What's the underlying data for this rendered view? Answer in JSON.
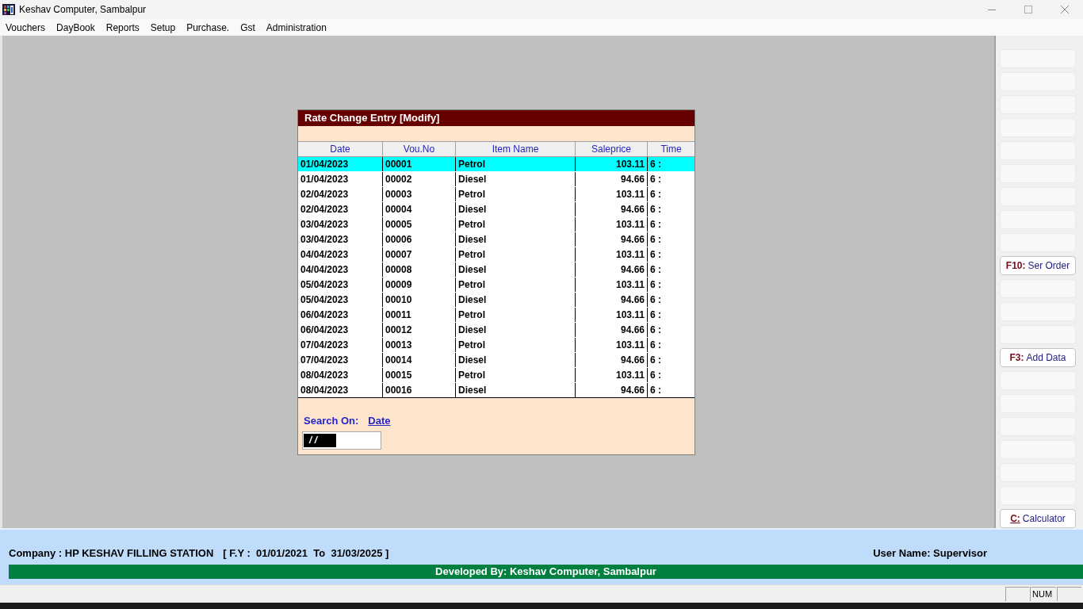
{
  "window": {
    "title": "Keshav Computer, Sambalpur"
  },
  "menu_bar": [
    "Vouchers",
    "DayBook",
    "Reports",
    "Setup",
    "Purchase.",
    "Gst",
    "Administration"
  ],
  "dialog": {
    "title": "Rate Change Entry [Modify]",
    "table": {
      "columns": [
        "Date",
        "Vou.No",
        "Item Name",
        "Saleprice",
        "Time"
      ],
      "rows": [
        {
          "cells": [
            "01/04/2023",
            "00001",
            "Petrol",
            "103.11",
            "6 :"
          ],
          "selected": true
        },
        {
          "cells": [
            "01/04/2023",
            "00002",
            "Diesel",
            "94.66",
            "6 :"
          ],
          "selected": false
        },
        {
          "cells": [
            "02/04/2023",
            "00003",
            "Petrol",
            "103.11",
            "6 :"
          ],
          "selected": false
        },
        {
          "cells": [
            "02/04/2023",
            "00004",
            "Diesel",
            "94.66",
            "6 :"
          ],
          "selected": false
        },
        {
          "cells": [
            "03/04/2023",
            "00005",
            "Petrol",
            "103.11",
            "6 :"
          ],
          "selected": false
        },
        {
          "cells": [
            "03/04/2023",
            "00006",
            "Diesel",
            "94.66",
            "6 :"
          ],
          "selected": false
        },
        {
          "cells": [
            "04/04/2023",
            "00007",
            "Petrol",
            "103.11",
            "6 :"
          ],
          "selected": false
        },
        {
          "cells": [
            "04/04/2023",
            "00008",
            "Diesel",
            "94.66",
            "6 :"
          ],
          "selected": false
        },
        {
          "cells": [
            "05/04/2023",
            "00009",
            "Petrol",
            "103.11",
            "6 :"
          ],
          "selected": false
        },
        {
          "cells": [
            "05/04/2023",
            "00010",
            "Diesel",
            "94.66",
            "6 :"
          ],
          "selected": false
        },
        {
          "cells": [
            "06/04/2023",
            "00011",
            "Petrol",
            "103.11",
            "6 :"
          ],
          "selected": false
        },
        {
          "cells": [
            "06/04/2023",
            "00012",
            "Diesel",
            "94.66",
            "6 :"
          ],
          "selected": false
        },
        {
          "cells": [
            "07/04/2023",
            "00013",
            "Petrol",
            "103.11",
            "6 :"
          ],
          "selected": false
        },
        {
          "cells": [
            "07/04/2023",
            "00014",
            "Diesel",
            "94.66",
            "6 :"
          ],
          "selected": false
        },
        {
          "cells": [
            "08/04/2023",
            "00015",
            "Petrol",
            "103.11",
            "6 :"
          ],
          "selected": false
        },
        {
          "cells": [
            "08/04/2023",
            "00016",
            "Diesel",
            "94.66",
            "6 :"
          ],
          "selected": false
        }
      ]
    },
    "search": {
      "label": "Search On:",
      "field": "Date",
      "value": "/ /",
      "value_selected": true
    }
  },
  "side_panel": {
    "buttons": [
      {
        "kind": "blank"
      },
      {
        "kind": "blank"
      },
      {
        "kind": "blank"
      },
      {
        "kind": "blank"
      },
      {
        "kind": "blank"
      },
      {
        "kind": "blank"
      },
      {
        "kind": "blank"
      },
      {
        "kind": "blank"
      },
      {
        "kind": "blank"
      },
      {
        "kind": "command",
        "key": "F10:",
        "label": "Ser Order",
        "underlined": false
      },
      {
        "kind": "blank"
      },
      {
        "kind": "blank"
      },
      {
        "kind": "blank"
      },
      {
        "kind": "command",
        "key": "F3:",
        "label": "Add Data",
        "underlined": false
      },
      {
        "kind": "blank"
      },
      {
        "kind": "blank"
      },
      {
        "kind": "blank"
      },
      {
        "kind": "blank"
      },
      {
        "kind": "blank"
      },
      {
        "kind": "blank"
      },
      {
        "kind": "command",
        "key": "C:",
        "label": "Calculator",
        "underlined": true
      }
    ]
  },
  "footer": {
    "company": "Company : HP KESHAV FILLING STATION",
    "financial_year": "[ F.Y :  01/01/2021  To  31/03/2025 ]",
    "user": "User Name: Supervisor",
    "developer": "Developed By: Keshav Computer, Sambalpur"
  },
  "status_bar": {
    "panels": [
      {
        "kind": "empty"
      },
      {
        "kind": "text",
        "text": "NUM"
      },
      {
        "kind": "empty"
      }
    ]
  }
}
